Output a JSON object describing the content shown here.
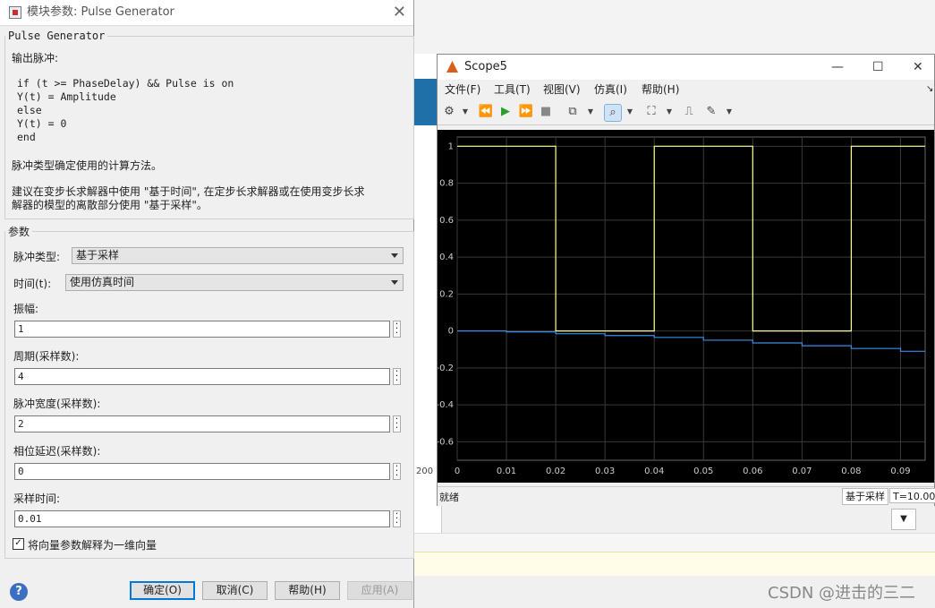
{
  "dialog": {
    "title": "模块参数: Pulse Generator",
    "section_title": "Pulse Generator",
    "desc1": "输出脉冲:",
    "code": "if (t >= PhaseDelay) && Pulse is on\nY(t) = Amplitude\nelse\nY(t) = 0\nend",
    "desc2": "脉冲类型确定使用的计算方法。",
    "desc3a": "建议在变步长求解器中使用 \"基于时间\", 在定步长求解器或在使用变步长求",
    "desc3b": "解器的模型的离散部分使用 \"基于采样\"。",
    "params_title": "参数",
    "pulse_type_label": "脉冲类型:",
    "pulse_type_value": "基于采样",
    "time_label": "时间(t):",
    "time_value": "使用仿真时间",
    "amplitude_label": "振幅:",
    "amplitude_value": "1",
    "period_label": "周期(采样数):",
    "period_value": "4",
    "width_label": "脉冲宽度(采样数):",
    "width_value": "2",
    "delay_label": "相位延迟(采样数):",
    "delay_value": "0",
    "sample_label": "采样时间:",
    "sample_value": "0.01",
    "checkbox_label": "将向量参数解释为一维向量",
    "checkbox_checked": true,
    "ok": "确定(O)",
    "cancel": "取消(C)",
    "help": "帮助(H)",
    "apply": "应用(A)",
    "help_icon": "?"
  },
  "scope": {
    "title": "Scope5",
    "menu": [
      "文件(F)",
      "工具(T)",
      "视图(V)",
      "仿真(I)",
      "帮助(H)"
    ],
    "status_text": "就绪",
    "mode": "基于采样",
    "time": "T=10.000"
  },
  "background": {
    "axis_label": "200",
    "dropdown_arrow": "▼"
  },
  "watermark": "CSDN @进击的三二",
  "chart_data": {
    "type": "line",
    "xlim": [
      0,
      0.095
    ],
    "ylim": [
      -0.7,
      1.05
    ],
    "xticks": [
      "0",
      "0.01",
      "0.02",
      "0.03",
      "0.04",
      "0.05",
      "0.06",
      "0.07",
      "0.08",
      "0.09"
    ],
    "yticks": [
      "1",
      "0.8",
      "0.6",
      "0.4",
      "0.2",
      "0",
      "-0.2",
      "-0.4",
      "-0.6"
    ],
    "grid": true,
    "series": [
      {
        "color": "#ffff99",
        "step": true,
        "x": [
          0,
          0.02,
          0.04,
          0.06,
          0.08,
          0.095
        ],
        "y": [
          1,
          0,
          1,
          0,
          1,
          1
        ]
      },
      {
        "color": "#3c8ce6",
        "step": true,
        "x": [
          0,
          0.01,
          0.02,
          0.03,
          0.04,
          0.05,
          0.06,
          0.07,
          0.08,
          0.09,
          0.095
        ],
        "y": [
          0,
          -0.005,
          -0.015,
          -0.025,
          -0.035,
          -0.05,
          -0.065,
          -0.08,
          -0.095,
          -0.11,
          -0.11
        ]
      }
    ]
  }
}
